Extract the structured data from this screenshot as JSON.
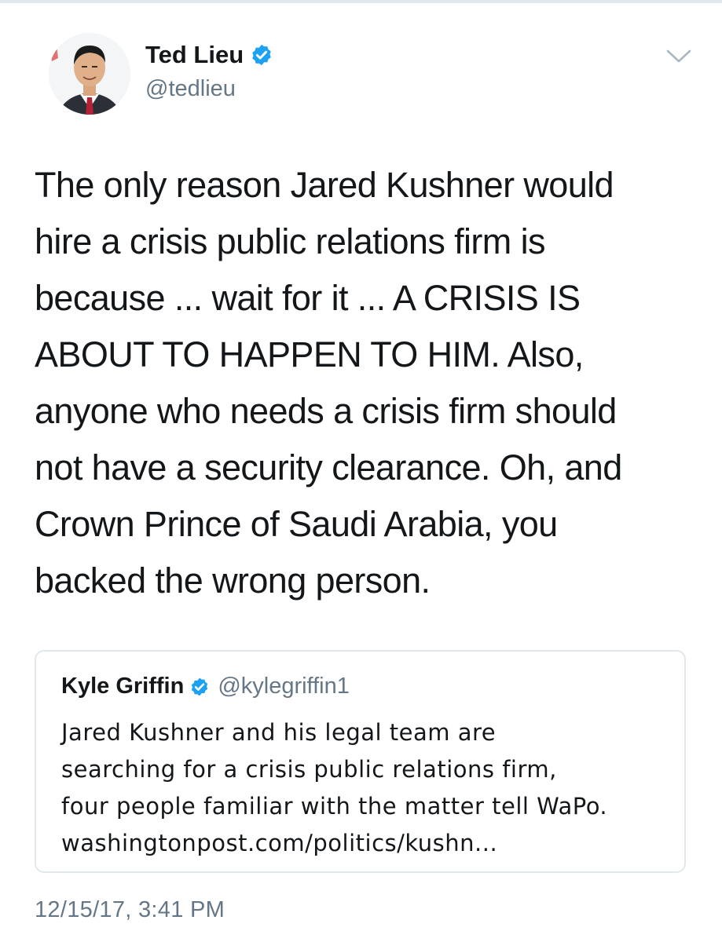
{
  "tweet": {
    "author": {
      "display_name": "Ted Lieu",
      "handle": "@tedlieu",
      "verified": true,
      "avatar_icon": "profile-photo"
    },
    "menu_icon": "chevron-down-icon",
    "text": "The only reason Jared Kushner would\nhire a crisis public relations firm is\nbecause ... wait for it ... A CRISIS IS\nABOUT TO HAPPEN TO HIM. Also,\nanyone who needs a crisis firm should\nnot have a security clearance. Oh, and\nCrown Prince of Saudi Arabia, you\nbacked the wrong person.",
    "timestamp": "12/15/17, 3:41 PM"
  },
  "quoted_tweet": {
    "display_name": "Kyle Griffin",
    "handle": "@kylegriffin1",
    "verified": true,
    "text": "Jared Kushner and his legal team are\nsearching for a crisis public relations firm,\nfour people familiar with the matter tell WaPo.\nwashingtonpost.com/politics/kushn..."
  },
  "colors": {
    "text_primary": "#14171a",
    "text_secondary": "#657786",
    "verified_blue": "#1da1f2",
    "border": "#e1e8ed"
  }
}
